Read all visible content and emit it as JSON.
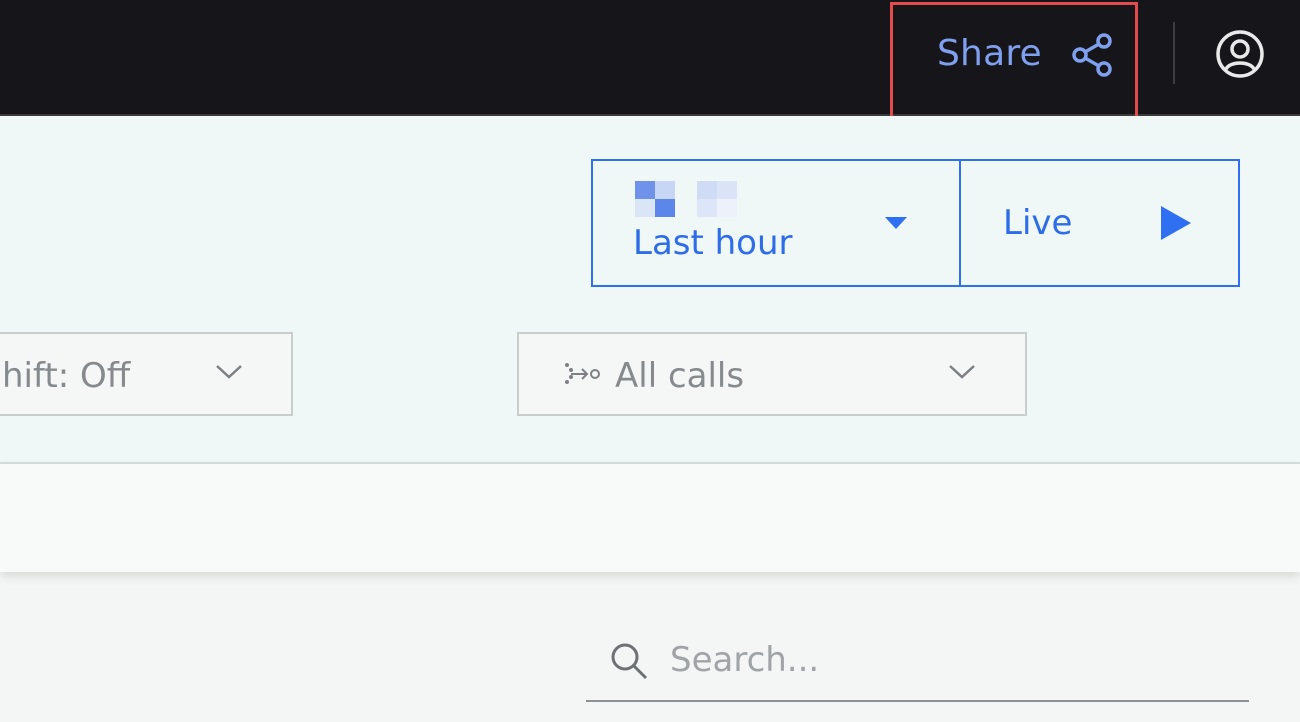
{
  "header": {
    "share_label": "Share",
    "share_icon": "share-icon",
    "user_icon": "user-avatar-icon"
  },
  "time_range": {
    "label": "Last hour",
    "caret_icon": "caret-down-icon",
    "live_label": "Live",
    "live_icon": "play-icon",
    "accent_color": "#2f6ff2"
  },
  "filters": {
    "shift_value": "hift: Off",
    "calls_value": "All calls",
    "calls_icon": "calls-icon",
    "chevron_icon": "chevron-down-icon"
  },
  "search": {
    "placeholder": "Search...",
    "icon": "search-icon"
  },
  "colors": {
    "header_bg": "#161519",
    "share_text": "#7ea0ee",
    "highlight_border": "#e34c4c",
    "panel_bg": "#eff7f7"
  }
}
